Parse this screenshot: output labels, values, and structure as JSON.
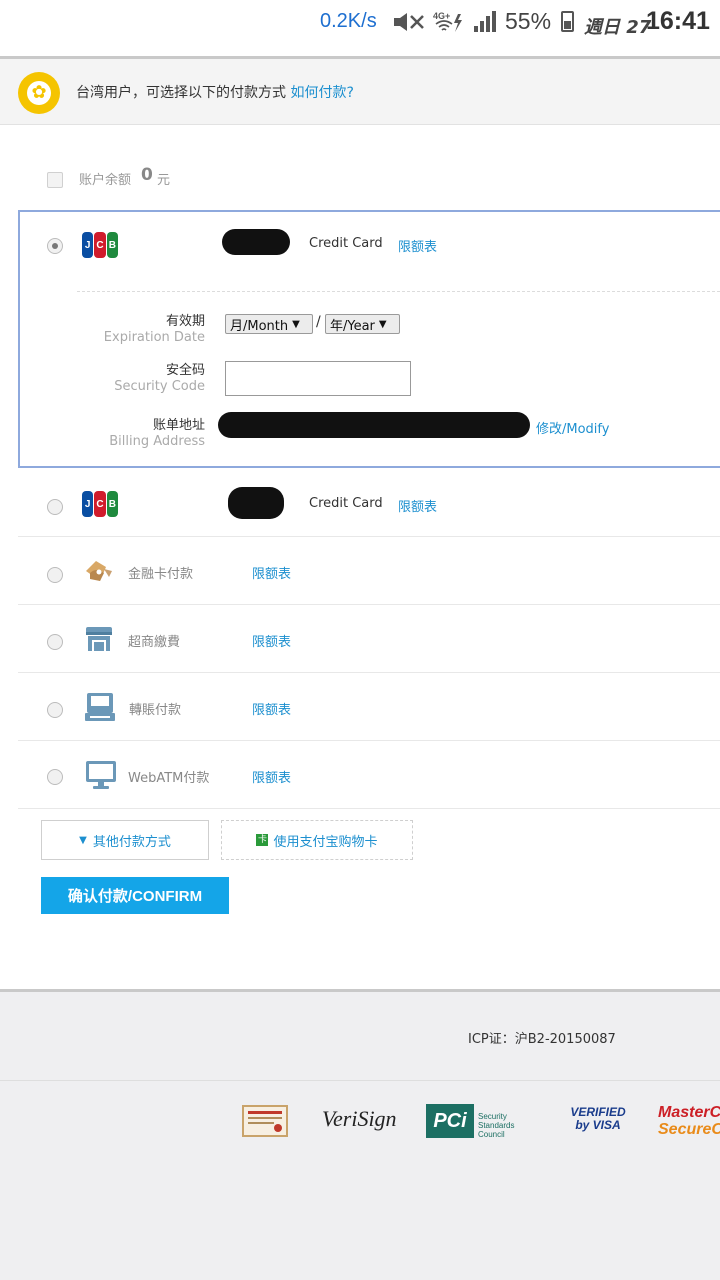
{
  "status_bar": {
    "net_speed": "0.2K/s",
    "network": "4G+",
    "battery_pct": "55%",
    "day": "週日 27",
    "time": "16:41"
  },
  "notice": {
    "text": "台湾用户，可选择以下的付款方式",
    "link": "如何付款?"
  },
  "balance": {
    "label": "账户余额",
    "amount": "0",
    "unit": "元"
  },
  "selected_card": {
    "brand": "JCB",
    "type_label": "Credit Card",
    "limit_link": "限额表",
    "expiration": {
      "label_zh": "有效期",
      "label_en": "Expiration Date",
      "month_value": "月/Month",
      "separator": "/",
      "year_value": "年/Year"
    },
    "security": {
      "label_zh": "安全码",
      "label_en": "Security Code",
      "value": ""
    },
    "billing": {
      "label_zh": "账单地址",
      "label_en": "Billing Address",
      "modify_link": "修改/Modify"
    }
  },
  "payment_methods": [
    {
      "name": "Credit Card",
      "brand": "JCB",
      "limit": "限额表",
      "icon": "jcb-icon"
    },
    {
      "name": "金融卡付款",
      "limit": "限额表",
      "icon": "bank-card-icon"
    },
    {
      "name": "超商繳費",
      "limit": "限额表",
      "icon": "store-icon"
    },
    {
      "name": "轉賬付款",
      "limit": "限额表",
      "icon": "atm-icon"
    },
    {
      "name": "WebATM付款",
      "limit": "限额表",
      "icon": "monitor-icon"
    }
  ],
  "buttons": {
    "other_methods": "其他付款方式",
    "gift_card": "使用支付宝购物卡",
    "gift_icon_char": "卡",
    "confirm": "确认付款/CONFIRM"
  },
  "footer": {
    "icp": "ICP证：沪B2-20150087",
    "logos": [
      "VeriSign",
      "PCI Security Standards Council",
      "VERIFIED by VISA",
      "MasterCard SecureCode"
    ],
    "verisign_text": "VeriSign",
    "pci_text": "PCi",
    "pci_sub": "Security Standards Council",
    "visa_line1": "VERIFIED",
    "visa_line2": "by VISA",
    "mc_line1": "MasterCard",
    "mc_line2": "SecureCode"
  },
  "colors": {
    "link": "#1c8fcf",
    "confirm_button": "#14a5e8",
    "selected_border": "#8ea9dd",
    "notice_logo": "#f5c400"
  }
}
